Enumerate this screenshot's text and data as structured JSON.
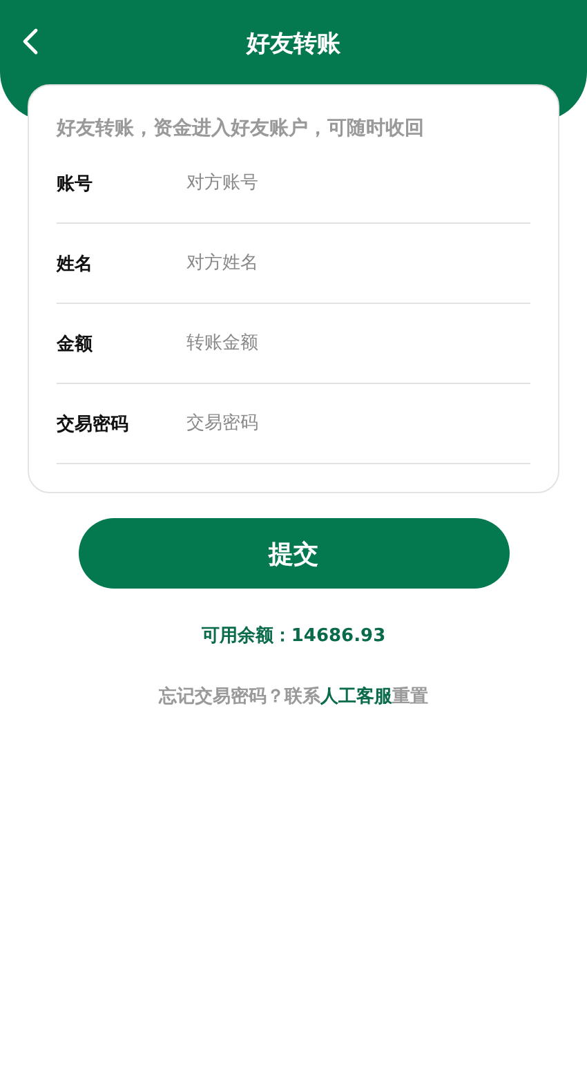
{
  "header": {
    "title": "好友转账"
  },
  "form": {
    "note": "好友转账，资金进入好友账户，可随时收回",
    "fields": [
      {
        "label": "账号",
        "placeholder": "对方账号"
      },
      {
        "label": "姓名",
        "placeholder": "对方姓名"
      },
      {
        "label": "金额",
        "placeholder": "转账金额"
      },
      {
        "label": "交易密码",
        "placeholder": "交易密码"
      }
    ]
  },
  "submit": {
    "label": "提交"
  },
  "balance": {
    "text": "可用余额：14686.93"
  },
  "help": {
    "before": "忘记交易密码？联系",
    "link": "人工客服",
    "after": "重置"
  }
}
